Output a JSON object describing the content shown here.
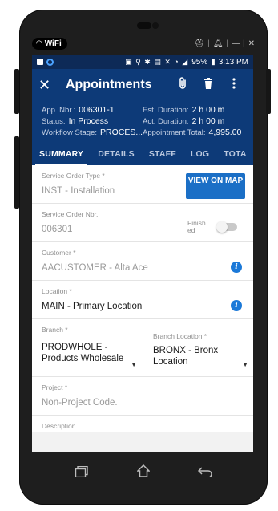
{
  "overlay": {
    "wifi_label": "WiFi"
  },
  "statusbar": {
    "battery": "95%",
    "time": "3:13 PM"
  },
  "appbar": {
    "title": "Appointments"
  },
  "header": {
    "app_nbr_label": "App. Nbr.:",
    "app_nbr": "006301-1",
    "est_duration_label": "Est. Duration:",
    "est_duration": "2 h 00 m",
    "status_label": "Status:",
    "status": "In Process",
    "act_duration_label": "Act. Duration:",
    "act_duration": "2 h 00 m",
    "workflow_label": "Workflow Stage:",
    "workflow": "PROCES...",
    "total_label": "Appointment Total:",
    "total": "4,995.00"
  },
  "tabs": [
    {
      "label": "SUMMARY"
    },
    {
      "label": "DETAILS"
    },
    {
      "label": "STAFF"
    },
    {
      "label": "LOG"
    },
    {
      "label": "TOTA"
    }
  ],
  "form": {
    "service_order_type_label": "Service Order Type *",
    "service_order_type": "INST - Installation",
    "view_map_label": "VIEW ON MAP",
    "service_order_nbr_label": "Service Order Nbr.",
    "service_order_nbr": "006301",
    "finished_label": "Finish ed",
    "customer_label": "Customer *",
    "customer": "AACUSTOMER - Alta Ace",
    "location_label": "Location *",
    "location": "MAIN - Primary Location",
    "branch_label": "Branch *",
    "branch": "PRODWHOLE - Products Wholesale",
    "branch_location_label": "Branch Location *",
    "branch_location": "BRONX - Bronx Location",
    "project_label": "Project *",
    "project": "Non-Project Code.",
    "next_label": "Description"
  },
  "colors": {
    "appbar": "#0d3a78",
    "accent": "#1b6fc6"
  }
}
